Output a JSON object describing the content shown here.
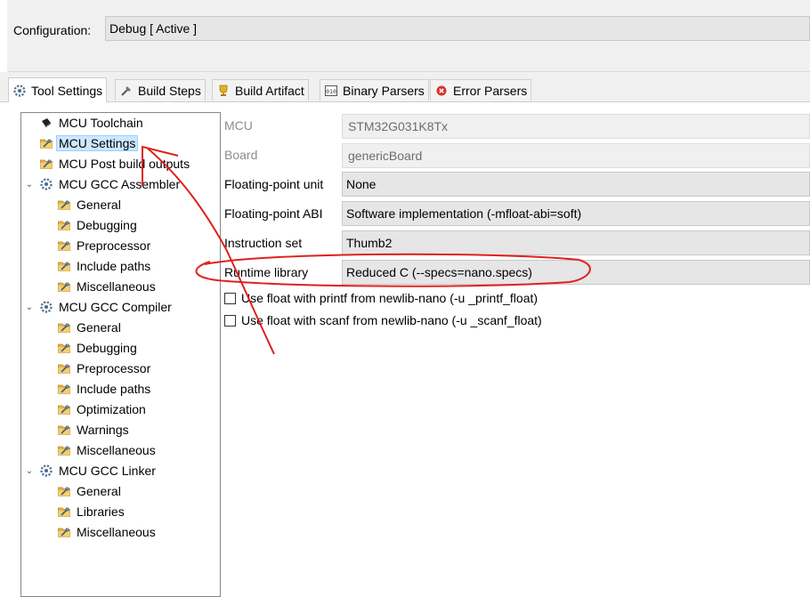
{
  "configuration": {
    "label": "Configuration:",
    "value": "Debug  [ Active ]"
  },
  "tabs": [
    {
      "label": "Tool Settings",
      "icon": "tool-settings-icon",
      "active": true
    },
    {
      "label": "Build Steps",
      "icon": "build-steps-icon",
      "active": false
    },
    {
      "label": "Build Artifact",
      "icon": "build-artifact-icon",
      "active": false
    },
    {
      "label": "Binary Parsers",
      "icon": "binary-parsers-icon",
      "active": false
    },
    {
      "label": "Error Parsers",
      "icon": "error-parsers-icon",
      "active": false
    }
  ],
  "tree": [
    {
      "label": "MCU Toolchain",
      "icon": "chip-icon"
    },
    {
      "label": "MCU Settings",
      "icon": "folder-settings-icon",
      "selected": true
    },
    {
      "label": "MCU Post build outputs",
      "icon": "folder-settings-icon"
    },
    {
      "label": "MCU GCC Assembler",
      "icon": "gear-tool-icon",
      "expanded": true,
      "children": [
        "General",
        "Debugging",
        "Preprocessor",
        "Include paths",
        "Miscellaneous"
      ]
    },
    {
      "label": "MCU GCC Compiler",
      "icon": "gear-tool-icon",
      "expanded": true,
      "children": [
        "General",
        "Debugging",
        "Preprocessor",
        "Include paths",
        "Optimization",
        "Warnings",
        "Miscellaneous"
      ]
    },
    {
      "label": "MCU GCC Linker",
      "icon": "gear-tool-icon",
      "expanded": true,
      "children": [
        "General",
        "Libraries",
        "Miscellaneous"
      ]
    }
  ],
  "form": {
    "mcu": {
      "label": "MCU",
      "value": "STM32G031K8Tx"
    },
    "board": {
      "label": "Board",
      "value": "genericBoard"
    },
    "fpu": {
      "label": "Floating-point unit",
      "value": "None"
    },
    "fpabi": {
      "label": "Floating-point ABI",
      "value": "Software implementation (-mfloat-abi=soft)"
    },
    "iset": {
      "label": "Instruction set",
      "value": "Thumb2"
    },
    "runtime": {
      "label": "Runtime library",
      "value": "Reduced C (--specs=nano.specs)"
    },
    "printf_float": {
      "label": "Use float with printf from newlib-nano (-u _printf_float)",
      "checked": false
    },
    "scanf_float": {
      "label": "Use float with scanf from newlib-nano (-u _scanf_float)",
      "checked": false
    }
  },
  "colors": {
    "annotation": "#e02020",
    "selection": "#cce8ff",
    "folder": "#e8b44a"
  }
}
